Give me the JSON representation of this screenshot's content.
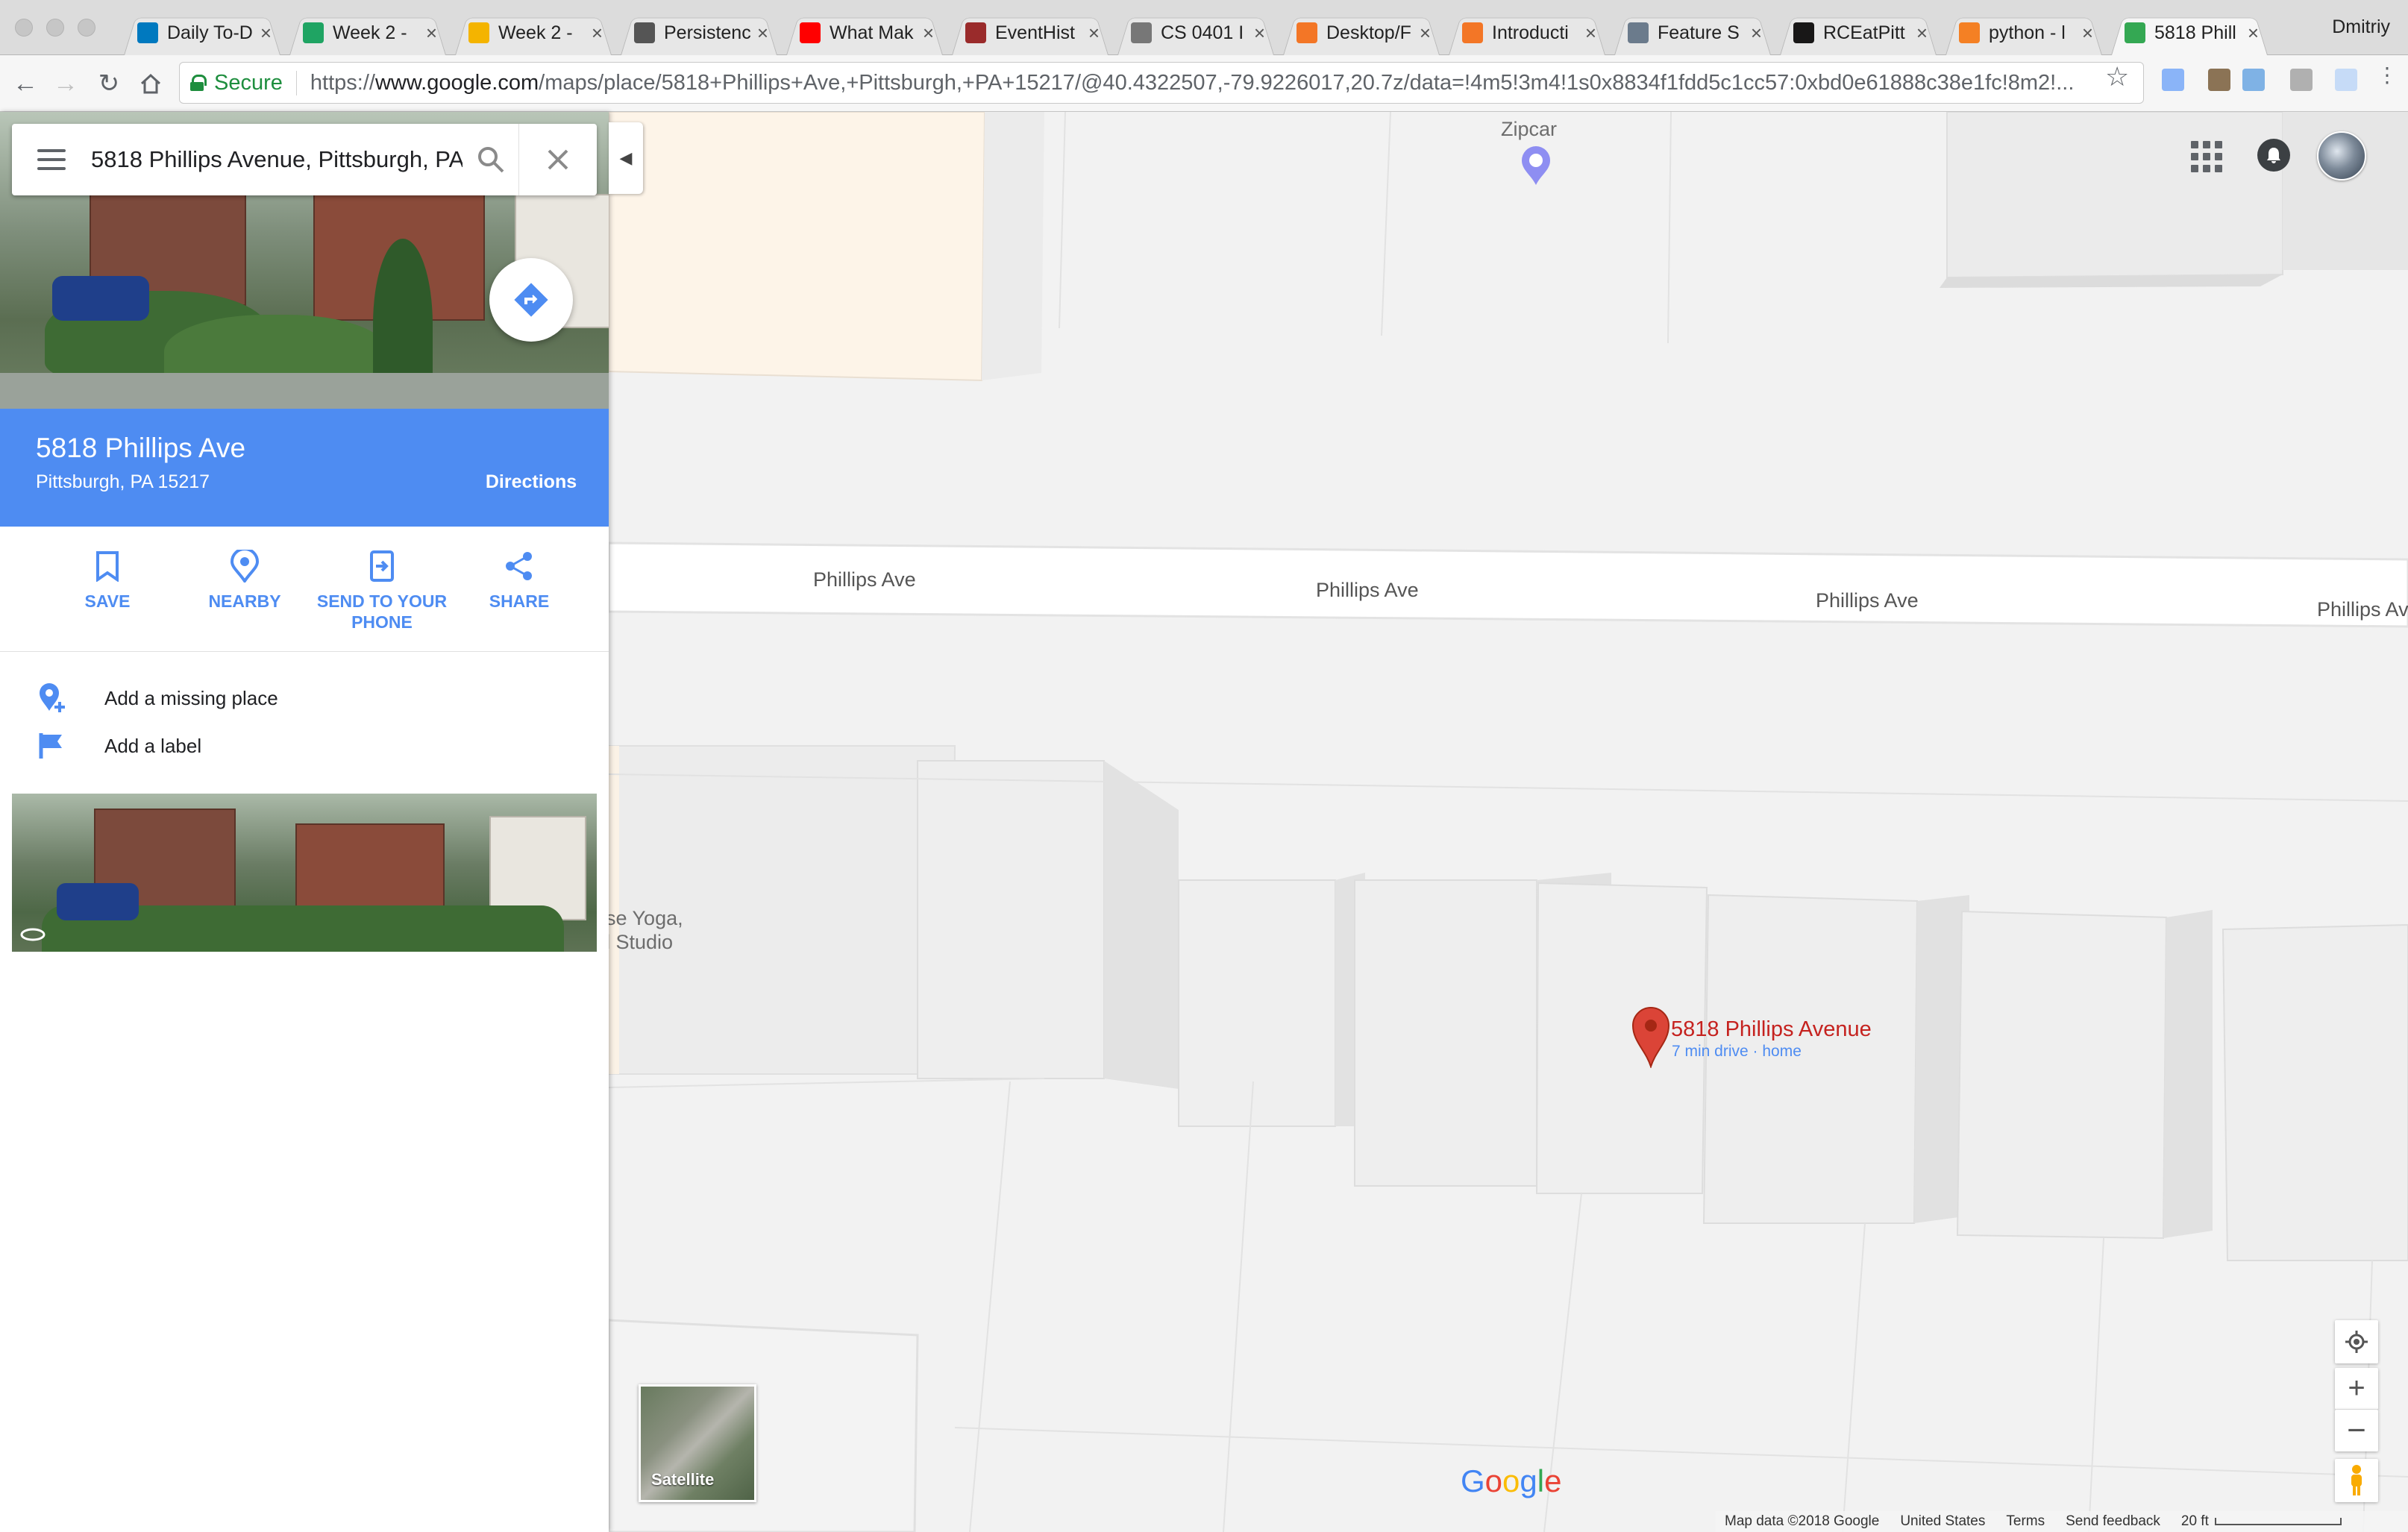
{
  "browser": {
    "tabs": [
      {
        "title": "Daily To-D",
        "icon": "trello-icon",
        "color": "#0079bf"
      },
      {
        "title": "Week 2 -",
        "icon": "drive-icon",
        "color": "#1fa463"
      },
      {
        "title": "Week 2 -",
        "icon": "slides-icon",
        "color": "#f4b400"
      },
      {
        "title": "Persistenc",
        "icon": "paper-plane-icon",
        "color": "#555555"
      },
      {
        "title": "What Mak",
        "icon": "youtube-icon",
        "color": "#ff0000"
      },
      {
        "title": "EventHist",
        "icon": "calendar-icon",
        "color": "#9a2b2b"
      },
      {
        "title": "CS 0401 I",
        "icon": "document-icon",
        "color": "#777777"
      },
      {
        "title": "Desktop/F",
        "icon": "jupyter-icon",
        "color": "#f37626"
      },
      {
        "title": "Introducti",
        "icon": "jupyter-icon",
        "color": "#f37626"
      },
      {
        "title": "Feature S",
        "icon": "person-icon",
        "color": "#6b7b8c"
      },
      {
        "title": "RCEatPitt",
        "icon": "github-icon",
        "color": "#181717"
      },
      {
        "title": "python - l",
        "icon": "stackoverflow-icon",
        "color": "#f48024"
      },
      {
        "title": "5818 Phill",
        "icon": "maps-icon",
        "color": "#34a853",
        "active": true
      }
    ],
    "profile_name": "Dmitriy",
    "secure_label": "Secure",
    "url_scheme": "https://",
    "url_host": "www.google.com",
    "url_path": "/maps/place/5818+Phillips+Ave,+Pittsburgh,+PA+15217/@40.4322507,-79.9226017,20.7z/data=!4m5!3m4!1s0x8834f1fdd5c1cc57:0xbd0e61888c38e1fc!8m2!..."
  },
  "search": {
    "value": "5818 Phillips Avenue, Pittsburgh, PA"
  },
  "place": {
    "title": "5818 Phillips Ave",
    "subtitle": "Pittsburgh, PA 15217",
    "directions_label": "Directions",
    "actions": [
      {
        "label": "SAVE",
        "icon": "bookmark-icon"
      },
      {
        "label": "NEARBY",
        "icon": "nearby-icon"
      },
      {
        "label": "SEND TO YOUR PHONE",
        "icon": "send-to-phone-icon"
      },
      {
        "label": "SHARE",
        "icon": "share-icon"
      }
    ],
    "links": [
      {
        "label": "Add a missing place",
        "icon": "add-place-icon"
      },
      {
        "label": "Add a label",
        "icon": "flag-icon"
      }
    ]
  },
  "map": {
    "street_labels": [
      "Phillips Ave",
      "Phillips Ave",
      "Phillips Ave",
      "Phillips Av"
    ],
    "poi_zipcar": "Zipcar",
    "poi_partial_top": "se",
    "poi_partial_yoga_1": "se Yoga,",
    "poi_partial_yoga_2": "l Studio",
    "pin_label": "5818 Phillips Avenue",
    "pin_sublabel": "7 min drive · home",
    "satellite_label": "Satellite",
    "footer": {
      "map_data": "Map data ©2018 Google",
      "region": "United States",
      "terms": "Terms",
      "feedback": "Send feedback",
      "scale": "20 ft"
    }
  },
  "colors": {
    "accent": "#4e8cf2",
    "pin": "#db4437",
    "secure": "#1e8e3e"
  }
}
